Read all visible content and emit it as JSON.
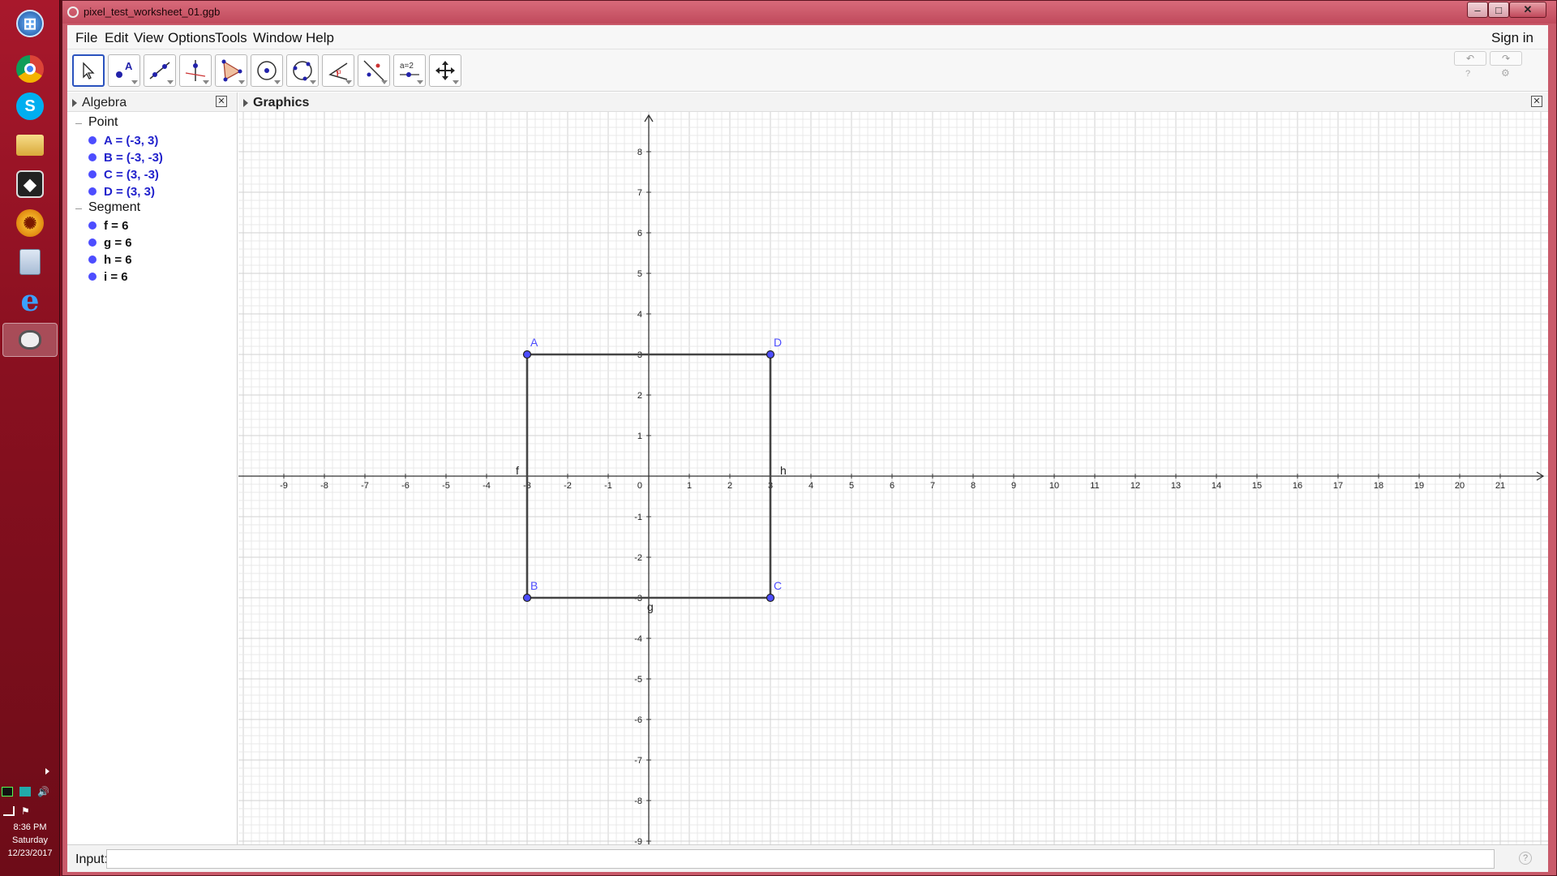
{
  "window": {
    "title": "pixel_test_worksheet_01.ggb"
  },
  "menu": {
    "items": [
      "File",
      "Edit",
      "View",
      "Options",
      "Tools",
      "Window",
      "Help"
    ],
    "sign_in": "Sign in"
  },
  "toolbar": {
    "tools": [
      "move-tool",
      "point-tool",
      "line-tool",
      "perpendicular-line-tool",
      "polygon-tool",
      "circle-center-point-tool",
      "circle-three-points-tool",
      "angle-tool",
      "reflect-tool",
      "slider-tool",
      "move-graphics-view-tool"
    ],
    "slider_label": "a=2",
    "selected": "move-tool"
  },
  "algebra": {
    "title": "Algebra",
    "groups": [
      {
        "label": "Point",
        "items": [
          "A = (-3, 3)",
          "B = (-3, -3)",
          "C = (3, -3)",
          "D = (3, 3)"
        ]
      },
      {
        "label": "Segment",
        "items": [
          "f = 6",
          "g = 6",
          "h = 6",
          "i = 6"
        ]
      }
    ]
  },
  "graphics": {
    "title": "Graphics",
    "x_ticks": [
      -9,
      -8,
      -7,
      -6,
      -5,
      -4,
      -3,
      -2,
      -1,
      1,
      2,
      3,
      4,
      5,
      6,
      7,
      8,
      9,
      10,
      11,
      12,
      13,
      14,
      15,
      16,
      17,
      18,
      19,
      20,
      21
    ],
    "y_ticks": [
      8,
      7,
      6,
      5,
      4,
      3,
      2,
      1,
      -1,
      -2,
      -3,
      -4,
      -5,
      -6,
      -7,
      -8,
      -9
    ],
    "origin_label": "0",
    "points": [
      {
        "name": "A",
        "x": -3,
        "y": 3
      },
      {
        "name": "B",
        "x": -3,
        "y": -3
      },
      {
        "name": "C",
        "x": 3,
        "y": -3
      },
      {
        "name": "D",
        "x": 3,
        "y": 3
      }
    ],
    "segments": [
      {
        "name": "f",
        "from": "A",
        "to": "B"
      },
      {
        "name": "g",
        "from": "B",
        "to": "C"
      },
      {
        "name": "h",
        "from": "C",
        "to": "D"
      },
      {
        "name": "i",
        "from": "D",
        "to": "A"
      }
    ],
    "colors": {
      "point": "#4d4dff",
      "segment": "#444444",
      "grid_minor": "#e8e8e8",
      "grid_major": "#d2d2d2"
    }
  },
  "input": {
    "label": "Input:",
    "value": ""
  },
  "taskbar": {
    "apps": [
      "windows-start-icon",
      "chrome-icon",
      "skype-icon",
      "file-explorer-icon",
      "inkscape-icon",
      "game-icon",
      "calculator-icon",
      "internet-explorer-icon",
      "geogebra-icon"
    ],
    "time": "8:36 PM",
    "day": "Saturday",
    "date": "12/23/2017"
  }
}
